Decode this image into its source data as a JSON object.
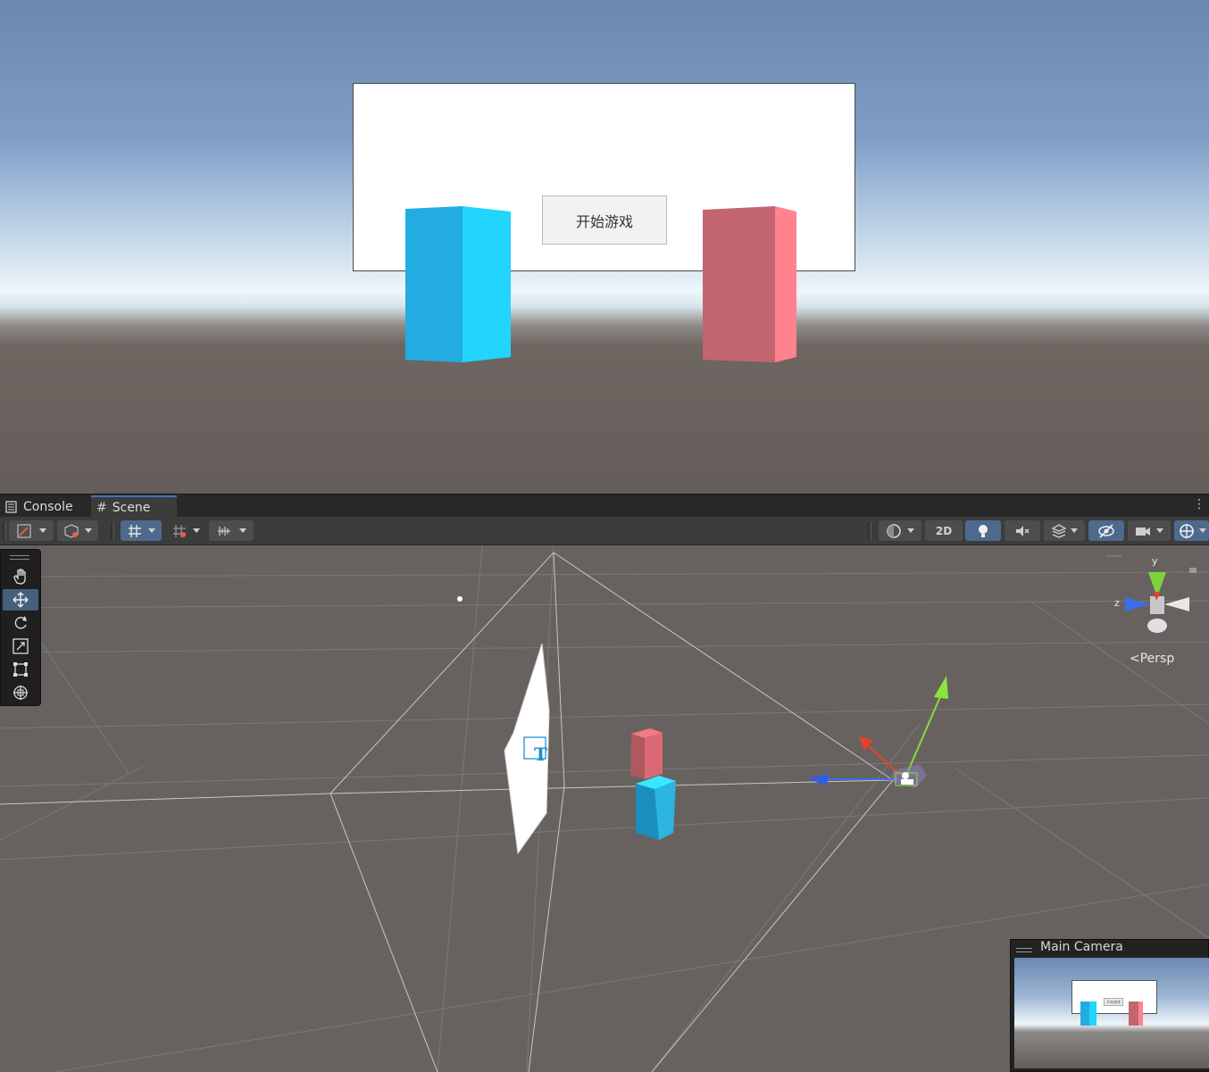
{
  "game_view": {
    "start_button_label": "开始游戏",
    "colors": {
      "cyan_cube": "#22b3e6",
      "pink_cube": "#c3666f",
      "panel": "#ffffff"
    }
  },
  "tabs": [
    {
      "label": "Console",
      "icon": "console-icon",
      "active": false
    },
    {
      "label": "Scene",
      "icon": "scene-grid-icon",
      "active": true
    }
  ],
  "toolbar": {
    "two_d_label": "2D",
    "icons": [
      "draw-mode-icon",
      "render-cube-icon",
      "grid-snap-icon",
      "increment-snap-icon",
      "ruler-icon",
      "shading-mode-icon",
      "lighting-icon",
      "audio-mute-icon",
      "effects-icon",
      "visibility-icon",
      "camera-icon",
      "gizmos-icon"
    ]
  },
  "tools": [
    "hand-tool-icon",
    "move-tool-icon",
    "rotate-tool-icon",
    "scale-tool-icon",
    "rect-tool-icon",
    "transform-tool-icon"
  ],
  "scene": {
    "persp_label": "Persp",
    "axis_y": "y",
    "axis_z": "z",
    "text_gizmo": "T",
    "accent_blue": "#3a79bb"
  },
  "camera_preview": {
    "title": "Main Camera",
    "button_label": "开始游戏"
  }
}
